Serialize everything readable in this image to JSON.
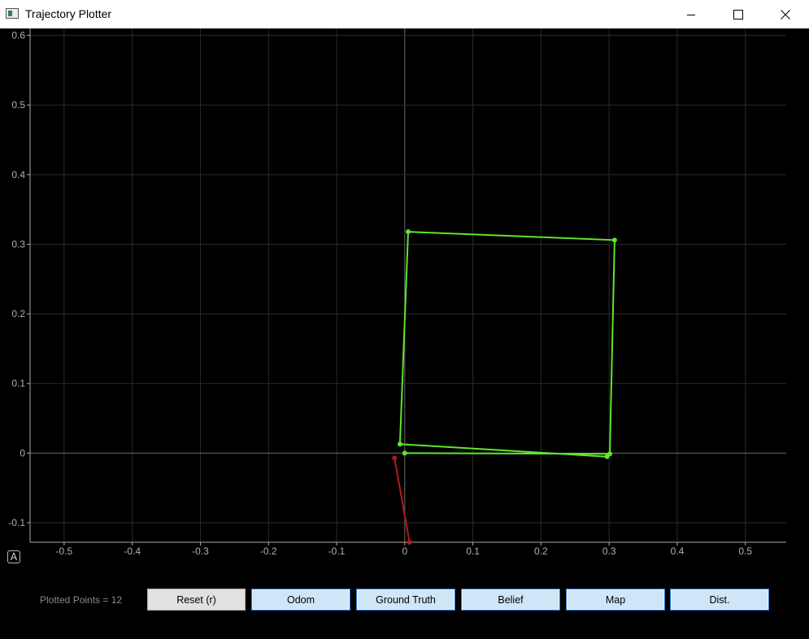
{
  "window": {
    "title": "Trajectory Plotter",
    "controls": [
      "minimize-icon",
      "maximize-icon",
      "close-icon"
    ]
  },
  "chart_data": {
    "type": "line",
    "xlim": [
      -0.55,
      0.56
    ],
    "ylim": [
      -0.128,
      0.61
    ],
    "x_ticks": [
      "-0.5",
      "-0.4",
      "-0.3",
      "-0.2",
      "-0.1",
      "0",
      "0.1",
      "0.2",
      "0.3",
      "0.4",
      "0.5"
    ],
    "x_tick_values": [
      -0.5,
      -0.4,
      -0.3,
      -0.2,
      -0.1,
      0,
      0.1,
      0.2,
      0.3,
      0.4,
      0.5
    ],
    "y_ticks": [
      "-0.1",
      "0",
      "0.1",
      "0.2",
      "0.3",
      "0.4",
      "0.5",
      "0.6"
    ],
    "y_tick_values": [
      -0.1,
      0,
      0.1,
      0.2,
      0.3,
      0.4,
      0.5,
      0.6
    ],
    "grid": true,
    "series": [
      {
        "color": "#5ee62b",
        "markers": true,
        "x": [
          0.0,
          0.301,
          0.308,
          0.005,
          -0.007,
          0.297
        ],
        "y": [
          0.0,
          -0.001,
          0.306,
          0.318,
          0.013,
          -0.005
        ]
      },
      {
        "color": "#b31b1b",
        "markers": true,
        "x": [
          -0.015,
          0.007
        ],
        "y": [
          -0.007,
          -0.128
        ]
      }
    ]
  },
  "controls": {
    "autoscale_label": "A",
    "points_label": "Plotted Points = 12",
    "buttons": [
      {
        "label": "Reset (r)"
      },
      {
        "label": "Odom"
      },
      {
        "label": "Ground Truth"
      },
      {
        "label": "Belief"
      },
      {
        "label": "Map"
      },
      {
        "label": "Dist."
      }
    ]
  }
}
